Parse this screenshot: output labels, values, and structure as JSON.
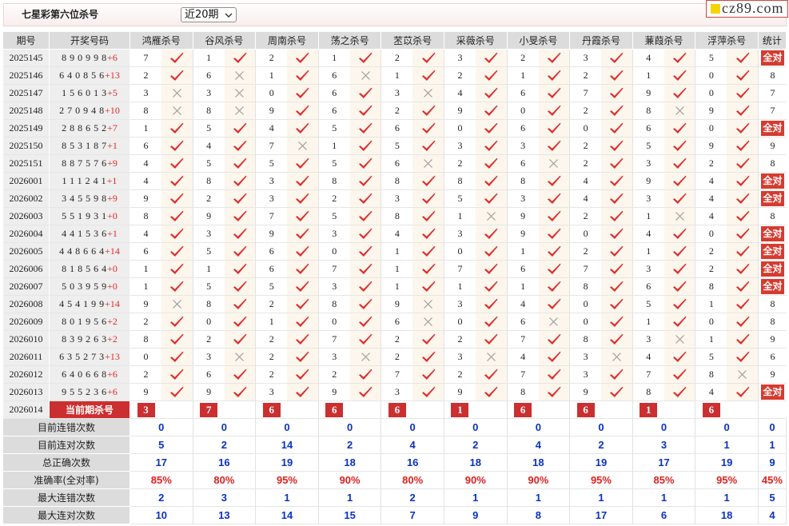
{
  "header": {
    "title": "七星彩第六位杀号",
    "period_select": {
      "selected": "近20期",
      "icon": "chevron-down-icon"
    },
    "logo": {
      "text": "cz89.com"
    }
  },
  "colors": {
    "check": "#e02b2b",
    "cross": "#9e9e9e",
    "extra_number": "#e02b2b",
    "badge": "#d63b30",
    "current_kill": "#cc2f2f",
    "logo_square": "#f5d400",
    "count": "#0b32c4",
    "rate": "#e01f1f"
  },
  "table": {
    "headers": {
      "period": "期号",
      "draw": "开奖号码",
      "stats": "统计"
    },
    "experts": [
      "鸿雁杀号",
      "谷风杀号",
      "周南杀号",
      "荡之杀号",
      "苤苡杀号",
      "采薇杀号",
      "小旻杀号",
      "丹霞杀号",
      "蒹葭杀号",
      "浮萍杀号"
    ],
    "rows": [
      {
        "period": "2025145",
        "main": "890998",
        "extra": "+6",
        "kills": [
          7,
          1,
          2,
          1,
          2,
          3,
          2,
          3,
          4,
          5
        ],
        "marks": [
          "check",
          "check",
          "check",
          "check",
          "check",
          "check",
          "check",
          "check",
          "check",
          "check"
        ],
        "stat": "全对"
      },
      {
        "period": "2025146",
        "main": "640856",
        "extra": "+13",
        "kills": [
          2,
          6,
          1,
          6,
          1,
          2,
          1,
          2,
          1,
          0
        ],
        "marks": [
          "check",
          "cross",
          "check",
          "cross",
          "check",
          "check",
          "check",
          "check",
          "check",
          "check"
        ],
        "stat": "8"
      },
      {
        "period": "2025147",
        "main": "156013",
        "extra": "+5",
        "kills": [
          3,
          3,
          0,
          6,
          3,
          4,
          6,
          7,
          9,
          0
        ],
        "marks": [
          "cross",
          "cross",
          "check",
          "check",
          "cross",
          "check",
          "check",
          "check",
          "check",
          "check"
        ],
        "stat": "7"
      },
      {
        "period": "2025148",
        "main": "270948",
        "extra": "+10",
        "kills": [
          8,
          8,
          9,
          6,
          2,
          9,
          0,
          2,
          8,
          9
        ],
        "marks": [
          "cross",
          "cross",
          "check",
          "check",
          "check",
          "check",
          "check",
          "check",
          "cross",
          "check"
        ],
        "stat": "7"
      },
      {
        "period": "2025149",
        "main": "288652",
        "extra": "+7",
        "kills": [
          1,
          5,
          4,
          5,
          6,
          0,
          6,
          0,
          6,
          0
        ],
        "marks": [
          "check",
          "check",
          "check",
          "check",
          "check",
          "check",
          "check",
          "check",
          "check",
          "check"
        ],
        "stat": "全对"
      },
      {
        "period": "2025150",
        "main": "853187",
        "extra": "+1",
        "kills": [
          6,
          4,
          7,
          1,
          5,
          3,
          3,
          2,
          5,
          9
        ],
        "marks": [
          "check",
          "check",
          "cross",
          "check",
          "check",
          "check",
          "check",
          "check",
          "check",
          "check"
        ],
        "stat": "9"
      },
      {
        "period": "2025151",
        "main": "887576",
        "extra": "+9",
        "kills": [
          4,
          5,
          5,
          5,
          6,
          2,
          6,
          2,
          3,
          2
        ],
        "marks": [
          "check",
          "check",
          "check",
          "check",
          "cross",
          "check",
          "cross",
          "check",
          "check",
          "check"
        ],
        "stat": "8"
      },
      {
        "period": "2026001",
        "main": "111241",
        "extra": "+1",
        "kills": [
          4,
          8,
          3,
          8,
          8,
          8,
          8,
          4,
          9,
          4
        ],
        "marks": [
          "check",
          "check",
          "check",
          "check",
          "check",
          "check",
          "check",
          "check",
          "check",
          "check"
        ],
        "stat": "全对"
      },
      {
        "period": "2026002",
        "main": "345598",
        "extra": "+9",
        "kills": [
          9,
          2,
          3,
          2,
          3,
          5,
          3,
          4,
          3,
          4
        ],
        "marks": [
          "check",
          "check",
          "check",
          "check",
          "check",
          "check",
          "check",
          "check",
          "check",
          "check"
        ],
        "stat": "全对"
      },
      {
        "period": "2026003",
        "main": "551931",
        "extra": "+0",
        "kills": [
          8,
          9,
          7,
          5,
          8,
          1,
          9,
          2,
          1,
          4
        ],
        "marks": [
          "check",
          "check",
          "check",
          "check",
          "check",
          "cross",
          "check",
          "check",
          "cross",
          "check"
        ],
        "stat": "8"
      },
      {
        "period": "2026004",
        "main": "441536",
        "extra": "+1",
        "kills": [
          4,
          3,
          9,
          3,
          4,
          3,
          9,
          0,
          4,
          0
        ],
        "marks": [
          "check",
          "check",
          "check",
          "check",
          "check",
          "check",
          "check",
          "check",
          "check",
          "check"
        ],
        "stat": "全对"
      },
      {
        "period": "2026005",
        "main": "448664",
        "extra": "+14",
        "kills": [
          6,
          5,
          6,
          0,
          1,
          0,
          1,
          2,
          1,
          2
        ],
        "marks": [
          "check",
          "check",
          "check",
          "check",
          "check",
          "check",
          "check",
          "check",
          "check",
          "check"
        ],
        "stat": "全对"
      },
      {
        "period": "2026006",
        "main": "818564",
        "extra": "+0",
        "kills": [
          1,
          1,
          6,
          7,
          1,
          7,
          6,
          7,
          3,
          2
        ],
        "marks": [
          "check",
          "check",
          "check",
          "check",
          "check",
          "check",
          "check",
          "check",
          "check",
          "check"
        ],
        "stat": "全对"
      },
      {
        "period": "2026007",
        "main": "503959",
        "extra": "+0",
        "kills": [
          1,
          5,
          5,
          3,
          1,
          1,
          1,
          8,
          6,
          8
        ],
        "marks": [
          "check",
          "check",
          "check",
          "check",
          "check",
          "check",
          "check",
          "check",
          "check",
          "check"
        ],
        "stat": "全对"
      },
      {
        "period": "2026008",
        "main": "454199",
        "extra": "+14",
        "kills": [
          9,
          8,
          2,
          8,
          9,
          3,
          4,
          0,
          5,
          1
        ],
        "marks": [
          "cross",
          "check",
          "check",
          "check",
          "cross",
          "check",
          "check",
          "check",
          "check",
          "check"
        ],
        "stat": "8"
      },
      {
        "period": "2026009",
        "main": "801956",
        "extra": "+2",
        "kills": [
          2,
          0,
          1,
          0,
          6,
          0,
          6,
          0,
          1,
          0
        ],
        "marks": [
          "check",
          "check",
          "check",
          "check",
          "cross",
          "check",
          "cross",
          "check",
          "check",
          "check"
        ],
        "stat": "8"
      },
      {
        "period": "2026010",
        "main": "839263",
        "extra": "+2",
        "kills": [
          8,
          2,
          2,
          7,
          2,
          2,
          7,
          8,
          3,
          1
        ],
        "marks": [
          "check",
          "check",
          "check",
          "check",
          "check",
          "check",
          "check",
          "check",
          "cross",
          "check"
        ],
        "stat": "9"
      },
      {
        "period": "2026011",
        "main": "635273",
        "extra": "+13",
        "kills": [
          0,
          3,
          2,
          3,
          2,
          3,
          4,
          3,
          4,
          5
        ],
        "marks": [
          "check",
          "cross",
          "check",
          "cross",
          "check",
          "cross",
          "check",
          "cross",
          "check",
          "check"
        ],
        "stat": "6"
      },
      {
        "period": "2026012",
        "main": "640668",
        "extra": "+6",
        "kills": [
          2,
          6,
          2,
          2,
          7,
          2,
          7,
          3,
          7,
          8
        ],
        "marks": [
          "check",
          "check",
          "check",
          "check",
          "check",
          "check",
          "check",
          "check",
          "check",
          "cross"
        ],
        "stat": "9"
      },
      {
        "period": "2026013",
        "main": "955236",
        "extra": "+6",
        "kills": [
          9,
          9,
          3,
          9,
          3,
          9,
          8,
          9,
          8,
          4
        ],
        "marks": [
          "check",
          "check",
          "check",
          "check",
          "check",
          "check",
          "check",
          "check",
          "check",
          "check"
        ],
        "stat": "全对"
      }
    ],
    "current": {
      "period": "2026014",
      "label": "当前期杀号",
      "kills": [
        3,
        7,
        6,
        6,
        6,
        1,
        6,
        6,
        1,
        6
      ]
    },
    "summary": [
      {
        "label": "目前连错次数",
        "values": [
          "0",
          "0",
          "0",
          "0",
          "0",
          "0",
          "0",
          "0",
          "0",
          "0"
        ],
        "total": "0",
        "color": "#0b32c4"
      },
      {
        "label": "目前连对次数",
        "values": [
          "5",
          "2",
          "14",
          "2",
          "4",
          "2",
          "4",
          "2",
          "3",
          "1"
        ],
        "total": "1",
        "color": "#0b32c4"
      },
      {
        "label": "总正确次数",
        "values": [
          "17",
          "16",
          "19",
          "18",
          "16",
          "18",
          "18",
          "19",
          "17",
          "19"
        ],
        "total": "9",
        "color": "#0b32c4"
      },
      {
        "label": "准确率(全对率)",
        "values": [
          "85%",
          "80%",
          "95%",
          "90%",
          "80%",
          "90%",
          "90%",
          "95%",
          "85%",
          "95%"
        ],
        "total": "45%",
        "color": "#e01f1f"
      },
      {
        "label": "最大连错次数",
        "values": [
          "2",
          "3",
          "1",
          "1",
          "2",
          "1",
          "1",
          "1",
          "1",
          "1"
        ],
        "total": "5",
        "color": "#0b32c4"
      },
      {
        "label": "最大连对次数",
        "values": [
          "10",
          "13",
          "14",
          "15",
          "7",
          "9",
          "8",
          "17",
          "6",
          "18"
        ],
        "total": "4",
        "color": "#0b32c4"
      }
    ]
  }
}
